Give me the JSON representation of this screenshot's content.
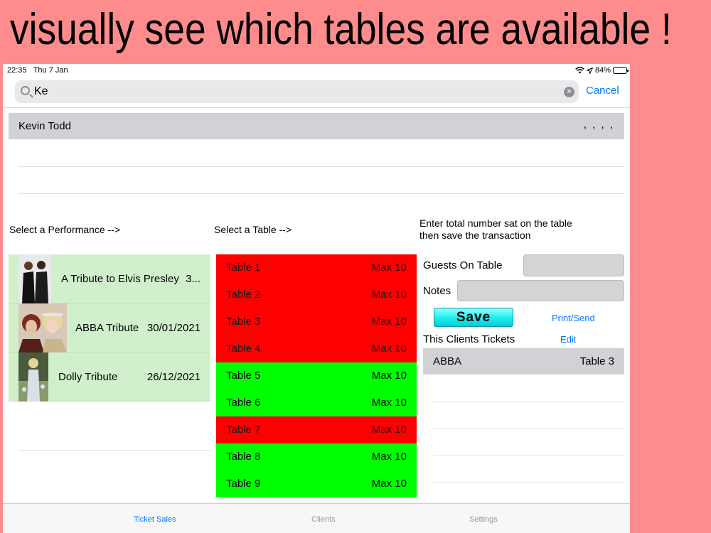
{
  "banner": "visually see which tables are available !",
  "status": {
    "time": "22:35",
    "date": "Thu 7 Jan",
    "battery": "84%",
    "battery_level": 0.84
  },
  "search": {
    "value": "Ke",
    "cancel_label": "Cancel"
  },
  "client": {
    "name": "Kevin Todd",
    "detail": ", , , ,"
  },
  "performance_prompt": "Select a Performance -->",
  "table_prompt": "Select a Table -->",
  "guests_prompt_line1": "Enter total number sat on the table",
  "guests_prompt_line2": "then save the transaction",
  "performances": [
    {
      "title": "A Tribute to Elvis Presley",
      "date": "3..."
    },
    {
      "title": "ABBA Tribute",
      "date": "30/01/2021"
    },
    {
      "title": "Dolly Tribute",
      "date": "26/12/2021"
    }
  ],
  "tables": [
    {
      "name": "Table 1",
      "max": "Max 10",
      "status": "occupied"
    },
    {
      "name": "Table 2",
      "max": "Max 10",
      "status": "occupied"
    },
    {
      "name": "Table 3",
      "max": "Max 10",
      "status": "occupied"
    },
    {
      "name": "Table 4",
      "max": "Max 10",
      "status": "occupied"
    },
    {
      "name": "Table 5",
      "max": "Max 10",
      "status": "available"
    },
    {
      "name": "Table 6",
      "max": "Max 10",
      "status": "available"
    },
    {
      "name": "Table 7",
      "max": "Max 10",
      "status": "occupied"
    },
    {
      "name": "Table 8",
      "max": "Max 10",
      "status": "available"
    },
    {
      "name": "Table 9",
      "max": "Max 10",
      "status": "available"
    }
  ],
  "form": {
    "guests_label": "Guests On Table",
    "guests_value": "",
    "notes_label": "Notes",
    "notes_value": "",
    "save_label": "Save",
    "print_label": "Print/Send",
    "tickets_label": "This Clients Tickets",
    "edit_label": "Edit"
  },
  "tickets": [
    {
      "show": "ABBA",
      "table": "Table 3"
    }
  ],
  "tabbar": {
    "tab1": "Ticket Sales",
    "tab2": "Clients",
    "tab3": "Settings"
  },
  "colors": {
    "occupied": "#ff0000",
    "available": "#00ff00",
    "accent": "#007aff",
    "performance_row": "#d0f0cc"
  }
}
